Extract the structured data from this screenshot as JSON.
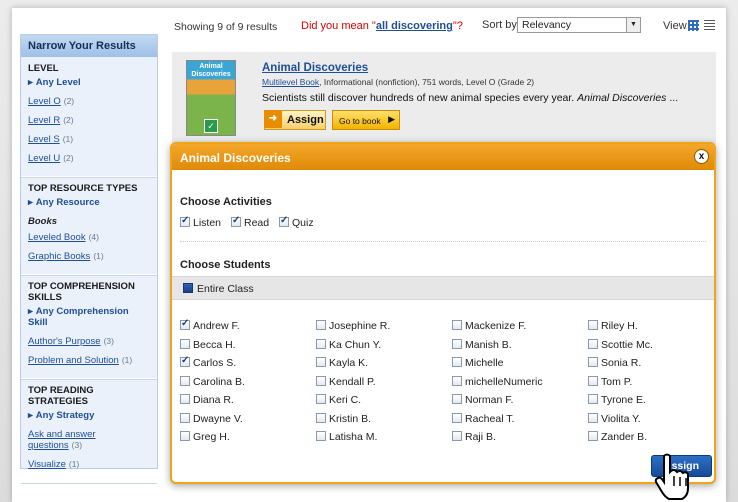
{
  "topbar": {
    "results": "Showing 9 of 9 results",
    "didyoumean_prefix": "Did you mean \"",
    "didyoumean_term": "all discovering",
    "didyoumean_suffix": "\"?",
    "sort_label": "Sort by",
    "sort_value": "Relevancy",
    "view_label": "View"
  },
  "sidebar": {
    "heading": "Narrow Your Results",
    "level": {
      "title": "LEVEL",
      "any": "Any Level",
      "links": [
        {
          "label": "Level O",
          "count": "(2)"
        },
        {
          "label": "Level R",
          "count": "(2)"
        },
        {
          "label": "Level S",
          "count": "(1)"
        },
        {
          "label": "Level U",
          "count": "(2)"
        }
      ]
    },
    "resource": {
      "title": "TOP RESOURCE TYPES",
      "any": "Any Resource",
      "sub": "Books",
      "links": [
        {
          "label": "Leveled Book",
          "count": "(4)"
        },
        {
          "label": "Graphic Books",
          "count": "(1)"
        }
      ]
    },
    "comprehension": {
      "title": "TOP COMPREHENSION SKILLS",
      "any": "Any Comprehension Skill",
      "links": [
        {
          "label": "Author's Purpose",
          "count": "(3)"
        },
        {
          "label": "Problem and Solution",
          "count": "(1)"
        }
      ]
    },
    "strategies": {
      "title": "TOP READING STRATEGIES",
      "any": "Any Strategy",
      "links": [
        {
          "label": "Ask and answer questions",
          "count": "(3)"
        },
        {
          "label": "Visualize",
          "count": "(1)"
        }
      ]
    }
  },
  "result": {
    "cover_title": "Animal Discoveries",
    "title": "Animal Discoveries",
    "meta_link": "Multilevel Book",
    "meta_rest": ", Informational (nonfiction), 751 words, Level O (Grade 2)",
    "desc_plain": "Scientists still discover hundreds of new animal species every year. ",
    "desc_italic": "Animal Discoveries",
    "desc_tail": " ...",
    "assign_label": "Assign",
    "goto_label": "Go to book"
  },
  "modal": {
    "title": "Animal Discoveries",
    "close_label": "x",
    "activities_title": "Choose Activities",
    "activities": [
      {
        "label": "Listen",
        "checked": true
      },
      {
        "label": "Read",
        "checked": true
      },
      {
        "label": "Quiz",
        "checked": true
      }
    ],
    "students_title": "Choose Students",
    "entire_class": "Entire Class",
    "students": [
      [
        {
          "name": "Andrew F.",
          "checked": true
        },
        {
          "name": "Becca H.",
          "checked": false
        },
        {
          "name": "Carlos S.",
          "checked": true
        },
        {
          "name": "Carolina B.",
          "checked": false
        },
        {
          "name": "Diana R.",
          "checked": false
        },
        {
          "name": "Dwayne V.",
          "checked": false
        },
        {
          "name": "Greg H.",
          "checked": false
        }
      ],
      [
        {
          "name": "Josephine R.",
          "checked": false
        },
        {
          "name": "Ka Chun Y.",
          "checked": false
        },
        {
          "name": "Kayla K.",
          "checked": false
        },
        {
          "name": "Kendall P.",
          "checked": false
        },
        {
          "name": "Keri C.",
          "checked": false
        },
        {
          "name": "Kristin B.",
          "checked": false
        },
        {
          "name": "Latisha M.",
          "checked": false
        }
      ],
      [
        {
          "name": "Mackenize F.",
          "checked": false
        },
        {
          "name": "Manish B.",
          "checked": false
        },
        {
          "name": "Michelle",
          "checked": false
        },
        {
          "name": "michelleNumeric",
          "checked": false
        },
        {
          "name": "Norman F.",
          "checked": false
        },
        {
          "name": "Racheal T.",
          "checked": false
        },
        {
          "name": "Raji B.",
          "checked": false
        }
      ],
      [
        {
          "name": "Riley H.",
          "checked": false
        },
        {
          "name": "Scottie Mc.",
          "checked": false
        },
        {
          "name": "Sonia R.",
          "checked": false
        },
        {
          "name": "Tom P.",
          "checked": false
        },
        {
          "name": "Tyrone E.",
          "checked": false
        },
        {
          "name": "Violita Y.",
          "checked": false
        },
        {
          "name": "Zander B.",
          "checked": false
        }
      ]
    ],
    "assign_label": "Assign"
  }
}
